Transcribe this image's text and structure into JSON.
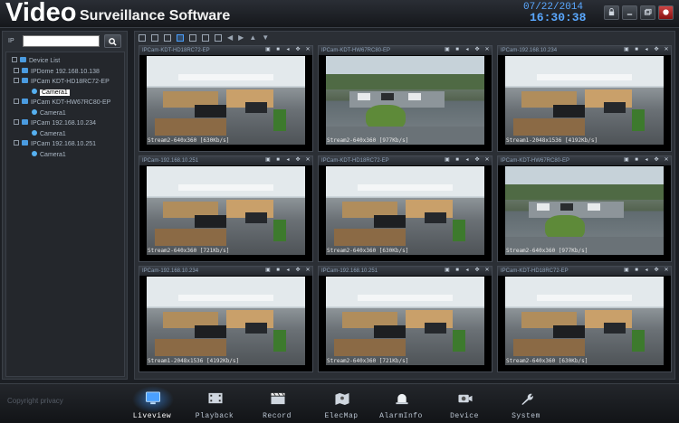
{
  "header": {
    "brand_big": "Video",
    "brand_small": "Surveillance Software",
    "date": "07/22/2014",
    "time": "16:30:38",
    "window_buttons": [
      "settings",
      "minimize",
      "restore",
      "close"
    ]
  },
  "sidebar": {
    "ip_label": "IP",
    "ip_value": "",
    "tree": [
      {
        "label": "Device List",
        "level": 0,
        "type": "root"
      },
      {
        "label": "IPDome 192.168.10.138",
        "level": 1,
        "type": "device"
      },
      {
        "label": "IPCam KDT-HD18RC72-EP",
        "level": 1,
        "type": "device"
      },
      {
        "label": "Camera1",
        "level": 2,
        "type": "camera",
        "selected": true
      },
      {
        "label": "IPCam KDT-HW67RC80-EP",
        "level": 1,
        "type": "device"
      },
      {
        "label": "Camera1",
        "level": 2,
        "type": "camera"
      },
      {
        "label": "IPCam 192.168.10.234",
        "level": 1,
        "type": "device"
      },
      {
        "label": "Camera1",
        "level": 2,
        "type": "camera"
      },
      {
        "label": "IPCam 192.168.10.251",
        "level": 1,
        "type": "device"
      },
      {
        "label": "Camera1",
        "level": 2,
        "type": "camera"
      }
    ]
  },
  "tiles": [
    {
      "title": "IPCam-KDT-HD18RC72-EP",
      "stream": "Stream2-640x360 [630Kb/s]",
      "scene": "office"
    },
    {
      "title": "IPCam-KDT-HW67RC80-EP",
      "stream": "Stream2-640x360 [977Kb/s]",
      "scene": "outdoor"
    },
    {
      "title": "IPCam-192.168.10.234",
      "stream": "Stream1-2048x1536 [4192Kb/s]",
      "scene": "office"
    },
    {
      "title": "IPCam-192.168.10.251",
      "stream": "Stream2-640x360 [721Kb/s]",
      "scene": "office"
    },
    {
      "title": "IPCam-KDT-HD18RC72-EP",
      "stream": "Stream2-640x360 [630Kb/s]",
      "scene": "office"
    },
    {
      "title": "IPCam-KDT-HW67RC80-EP",
      "stream": "Stream2-640x360 [977Kb/s]",
      "scene": "outdoor"
    },
    {
      "title": "IPCam-192.168.10.234",
      "stream": "Stream1-2048x1536 [4192Kb/s]",
      "scene": "office"
    },
    {
      "title": "IPCam-192.168.10.251",
      "stream": "Stream2-640x360 [721Kb/s]",
      "scene": "office"
    },
    {
      "title": "IPCam-KDT-HD18RC72-EP",
      "stream": "Stream2-640x360 [630Kb/s]",
      "scene": "office"
    }
  ],
  "footer": {
    "copyright": "Copyright privacy",
    "nav": [
      {
        "label": "Liveview",
        "icon": "monitor-icon",
        "active": true
      },
      {
        "label": "Playback",
        "icon": "film-icon",
        "active": false
      },
      {
        "label": "Record",
        "icon": "clapper-icon",
        "active": false
      },
      {
        "label": "ElecMap",
        "icon": "map-icon",
        "active": false
      },
      {
        "label": "AlarmInfo",
        "icon": "alarm-icon",
        "active": false
      },
      {
        "label": "Device",
        "icon": "camera-icon",
        "active": false
      },
      {
        "label": "System",
        "icon": "wrench-icon",
        "active": false
      }
    ]
  },
  "colors": {
    "accent": "#4aa0ff",
    "clock": "#5aa8ff"
  }
}
